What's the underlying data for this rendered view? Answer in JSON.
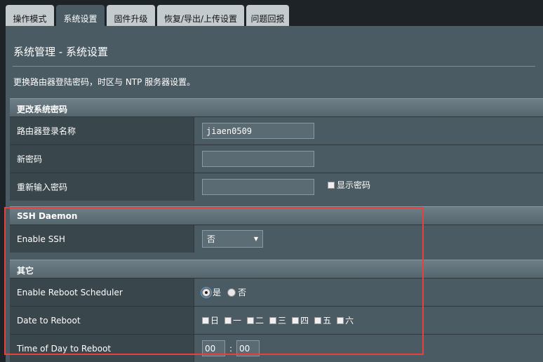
{
  "tabs": [
    {
      "label": "操作模式"
    },
    {
      "label": "系统设置"
    },
    {
      "label": "固件升级"
    },
    {
      "label": "恢复/导出/上传设置"
    },
    {
      "label": "问题回报"
    }
  ],
  "page": {
    "title": "系统管理 - 系统设置",
    "description": "更换路由器登陆密码，时区与 NTP 服务器设置。"
  },
  "password_section": {
    "header": "更改系统密码",
    "login_name_label": "路由器登录名称",
    "login_name_value": "jiaen0509",
    "new_password_label": "新密码",
    "new_password_value": "",
    "retype_password_label": "重新输入密码",
    "retype_password_value": "",
    "show_password_label": "显示密码"
  },
  "ssh_section": {
    "header": "SSH Daemon",
    "enable_ssh_label": "Enable SSH",
    "enable_ssh_value": "否"
  },
  "other_section": {
    "header": "其它",
    "reboot_scheduler_label": "Enable Reboot Scheduler",
    "reboot_yes": "是",
    "reboot_no": "否",
    "date_label": "Date to Reboot",
    "days": [
      "日",
      "一",
      "二",
      "三",
      "四",
      "五",
      "六"
    ],
    "time_label": "Time of Day to Reboot",
    "hour": "00",
    "separator": ":",
    "minute": "00"
  }
}
